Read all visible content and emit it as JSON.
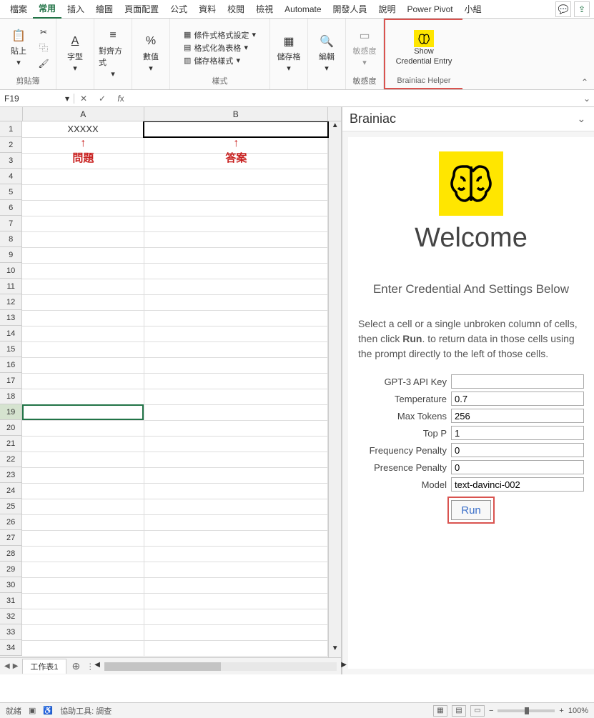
{
  "tabs": [
    "檔案",
    "常用",
    "插入",
    "繪圖",
    "頁面配置",
    "公式",
    "資料",
    "校閱",
    "檢視",
    "Automate",
    "開發人員",
    "說明",
    "Power Pivot",
    "小組"
  ],
  "activeTab": "常用",
  "ribbon": {
    "clipboard": {
      "paste": "貼上",
      "name": "剪貼簿"
    },
    "font": {
      "label": "字型",
      "name": "字型"
    },
    "align": {
      "label": "對齊方式",
      "name": "對齊方式"
    },
    "number": {
      "label": "數值",
      "name": "數值"
    },
    "styles": {
      "cond": "條件式格式設定",
      "table": "格式化為表格",
      "cell": "儲存格樣式",
      "name": "樣式"
    },
    "cells": {
      "label": "儲存格",
      "name": "儲存格"
    },
    "editing": {
      "label": "編輯",
      "name": "編輯"
    },
    "sensitivity": {
      "label": "敏感度",
      "name": "敏感度"
    },
    "brainiac": {
      "label1": "Show",
      "label2": "Credential Entry",
      "name": "Brainiac Helper"
    }
  },
  "nameBox": "F19",
  "formula": "",
  "columns": [
    "A",
    "B"
  ],
  "rows": [
    1,
    2,
    3,
    4,
    5,
    6,
    7,
    8,
    9,
    10,
    11,
    12,
    13,
    14,
    15,
    16,
    17,
    18,
    19,
    20,
    21,
    22,
    23,
    24,
    25,
    26,
    27,
    28,
    29,
    30,
    31,
    32,
    33,
    34
  ],
  "cells": {
    "A1": "XXXXX",
    "A2_annot": "問題",
    "B2_annot": "答案"
  },
  "selectedRow": 19,
  "sheetTab": "工作表1",
  "pane": {
    "title": "Brainiac",
    "welcome": "Welcome",
    "sub": "Enter Credential And Settings Below",
    "desc1": "Select a cell or a single unbroken column of cells, then click ",
    "descBold": "Run",
    "desc2": ". to return data in those cells using the prompt directly to the left of those cells.",
    "fields": {
      "apiKey": {
        "label": "GPT-3 API Key",
        "value": ""
      },
      "temp": {
        "label": "Temperature",
        "value": "0.7"
      },
      "maxTokens": {
        "label": "Max Tokens",
        "value": "256"
      },
      "topP": {
        "label": "Top P",
        "value": "1"
      },
      "freqPenalty": {
        "label": "Frequency Penalty",
        "value": "0"
      },
      "presPenalty": {
        "label": "Presence Penalty",
        "value": "0"
      },
      "model": {
        "label": "Model",
        "value": "text-davinci-002"
      }
    },
    "run": "Run"
  },
  "status": {
    "ready": "就緒",
    "access": "協助工具: 調查",
    "zoom": "100%"
  }
}
